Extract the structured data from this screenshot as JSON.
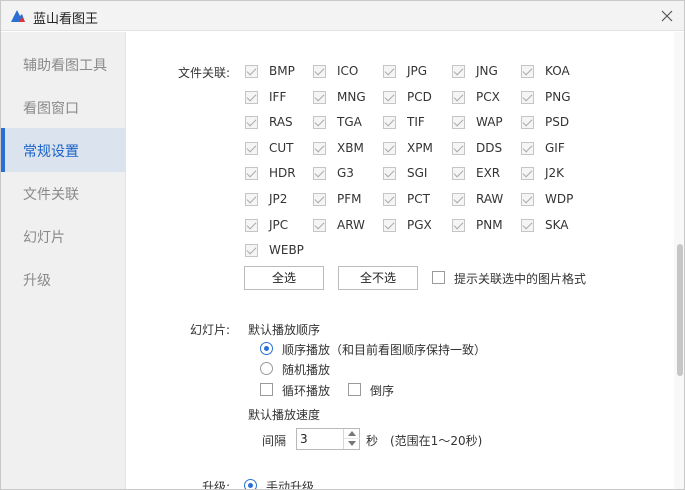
{
  "window": {
    "title": "蓝山看图王"
  },
  "sidebar": {
    "items": [
      {
        "label": "辅助看图工具"
      },
      {
        "label": "看图窗口"
      },
      {
        "label": "常规设置"
      },
      {
        "label": "文件关联"
      },
      {
        "label": "幻灯片"
      },
      {
        "label": "升级"
      }
    ],
    "active_index": 2
  },
  "file_assoc": {
    "label": "文件关联:",
    "formats": [
      [
        "BMP",
        "ICO",
        "JPG",
        "JNG",
        "KOA"
      ],
      [
        "IFF",
        "MNG",
        "PCD",
        "PCX",
        "PNG"
      ],
      [
        "RAS",
        "TGA",
        "TIF",
        "WAP",
        "PSD"
      ],
      [
        "CUT",
        "XBM",
        "XPM",
        "DDS",
        "GIF"
      ],
      [
        "HDR",
        "G3",
        "SGI",
        "EXR",
        "J2K"
      ],
      [
        "JP2",
        "PFM",
        "PCT",
        "RAW",
        "WDP"
      ],
      [
        "JPC",
        "ARW",
        "PGX",
        "PNM",
        "SKA"
      ],
      [
        "WEBP"
      ]
    ],
    "select_all": "全选",
    "select_none": "全不选",
    "prompt_label": "提示关联选中的图片格式",
    "prompt_checked": false
  },
  "slideshow": {
    "label": "幻灯片:",
    "order_heading": "默认播放顺序",
    "order_options": [
      "顺序播放（和目前看图顺序保持一致）",
      "随机播放"
    ],
    "order_selected": 0,
    "loop_label": "循环播放",
    "reverse_label": "倒序",
    "speed_heading": "默认播放速度",
    "interval_label": "间隔",
    "interval_value": "3",
    "seconds_label": "秒",
    "range_note": "(范围在1～20秒)"
  },
  "upgrade": {
    "label": "升级:",
    "option_label": "手动升级"
  },
  "colors": {
    "accent": "#2b6fd4",
    "sidebar_bg": "#f0f0f0",
    "sidebar_active_bg": "#dbe3ee"
  }
}
